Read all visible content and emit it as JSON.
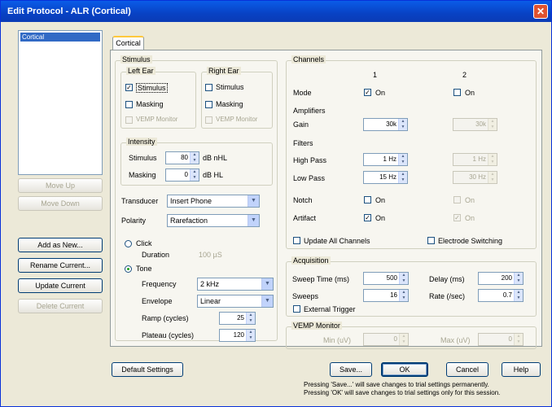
{
  "window": {
    "title": "Edit Protocol - ALR (Cortical)",
    "close_glyph": "✕"
  },
  "sidebar": {
    "list_items": [
      "Cortical"
    ],
    "buttons": {
      "move_up": "Move Up",
      "move_down": "Move Down",
      "add_as_new": "Add as New...",
      "rename_current": "Rename Current...",
      "update_current": "Update Current",
      "delete_current": "Delete Current"
    }
  },
  "tab": {
    "label": "Cortical"
  },
  "stimulus": {
    "group_label": "Stimulus",
    "left_ear": {
      "label": "Left Ear",
      "stimulus": "Stimulus",
      "masking": "Masking",
      "vemp": "VEMP Monitor"
    },
    "right_ear": {
      "label": "Right Ear",
      "stimulus": "Stimulus",
      "masking": "Masking",
      "vemp": "VEMP Monitor"
    },
    "intensity": {
      "label": "Intensity",
      "stimulus_label": "Stimulus",
      "stimulus_value": "80",
      "stimulus_unit": "dB nHL",
      "masking_label": "Masking",
      "masking_value": "0",
      "masking_unit": "dB HL"
    },
    "transducer": {
      "label": "Transducer",
      "value": "Insert Phone"
    },
    "polarity": {
      "label": "Polarity",
      "value": "Rarefaction"
    },
    "click": {
      "label": "Click",
      "duration_label": "Duration",
      "duration_value": "100 µS"
    },
    "tone": {
      "label": "Tone",
      "frequency_label": "Frequency",
      "frequency_value": "2 kHz",
      "envelope_label": "Envelope",
      "envelope_value": "Linear",
      "ramp_label": "Ramp (cycles)",
      "ramp_value": "25",
      "plateau_label": "Plateau (cycles)",
      "plateau_value": "120"
    }
  },
  "channels": {
    "group_label": "Channels",
    "col1": "1",
    "col2": "2",
    "mode_label": "Mode",
    "on_label": "On",
    "amplifiers_label": "Amplifiers",
    "gain_label": "Gain",
    "gain1": "30k",
    "gain2": "30k",
    "filters_label": "Filters",
    "highpass_label": "High Pass",
    "highpass1": "1 Hz",
    "highpass2": "1 Hz",
    "lowpass_label": "Low Pass",
    "lowpass1": "15 Hz",
    "lowpass2": "30 Hz",
    "notch_label": "Notch",
    "artifact_label": "Artifact",
    "update_all": "Update All Channels",
    "electrode_switching": "Electrode Switching"
  },
  "acquisition": {
    "group_label": "Acquisition",
    "sweep_time_label": "Sweep Time (ms)",
    "sweep_time_value": "500",
    "sweeps_label": "Sweeps",
    "sweeps_value": "16",
    "delay_label": "Delay (ms)",
    "delay_value": "200",
    "rate_label": "Rate (/sec)",
    "rate_value": "0.7",
    "external_trigger": "External Trigger"
  },
  "vemp_monitor": {
    "group_label": "VEMP Monitor",
    "min_label": "Min (uV)",
    "min_value": "0",
    "max_label": "Max (uV)",
    "max_value": "0"
  },
  "footer": {
    "default_settings": "Default Settings",
    "save": "Save...",
    "ok": "OK",
    "cancel": "Cancel",
    "help": "Help",
    "note_line1": "Pressing 'Save...' will save changes to trial settings permanently.",
    "note_line2": "Pressing 'OK' will save changes to trial settings only for this session."
  }
}
